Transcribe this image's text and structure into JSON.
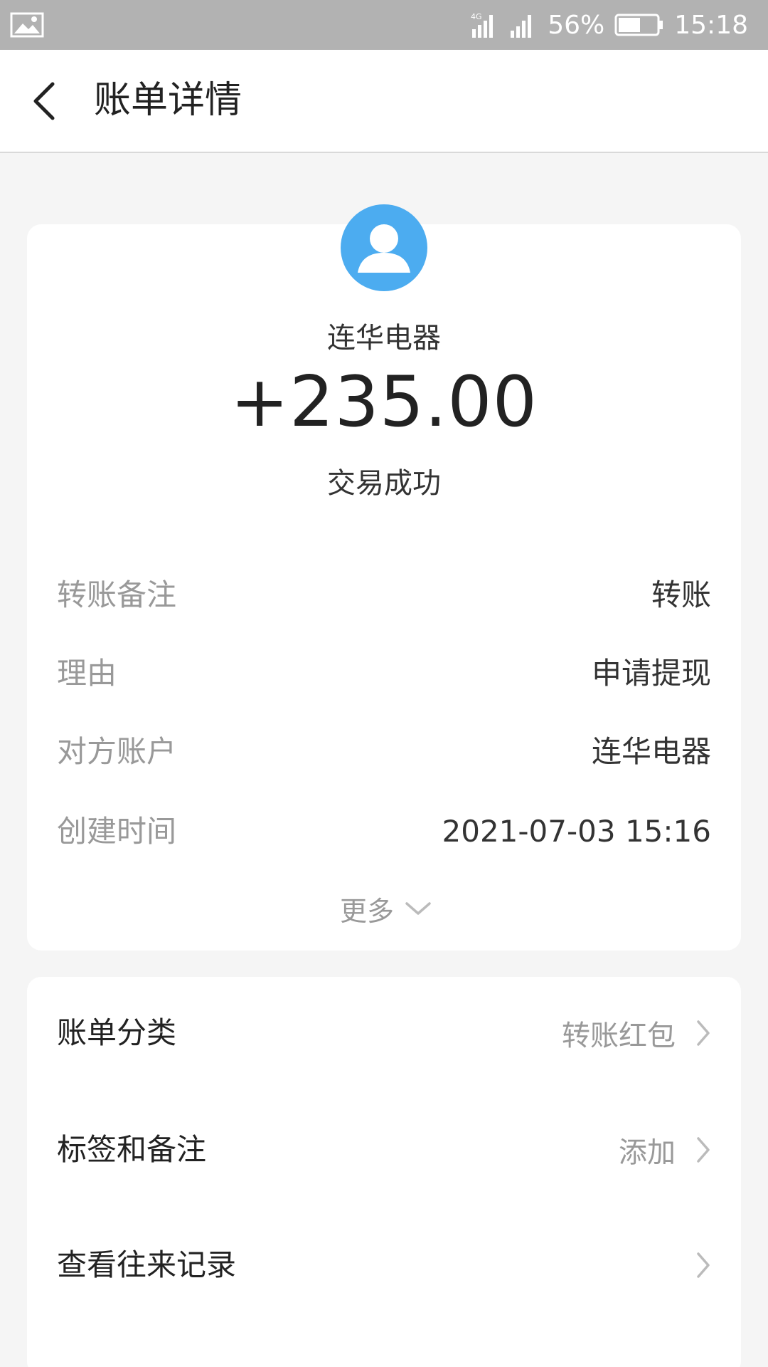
{
  "status_bar": {
    "network": "4G",
    "battery_percent": "56%",
    "time": "15:18"
  },
  "header": {
    "title": "账单详情"
  },
  "transaction": {
    "payee": "连华电器",
    "amount": "+235.00",
    "status": "交易成功"
  },
  "details": [
    {
      "label": "转账备注",
      "value": "转账"
    },
    {
      "label": "理由",
      "value": "申请提现"
    },
    {
      "label": "对方账户",
      "value": "连华电器"
    },
    {
      "label": "创建时间",
      "value": "2021-07-03 15:16"
    }
  ],
  "more": {
    "label": "更多"
  },
  "list": [
    {
      "label": "账单分类",
      "value": "转账红包"
    },
    {
      "label": "标签和备注",
      "value": "添加"
    },
    {
      "label": "查看往来记录",
      "value": ""
    }
  ],
  "colors": {
    "avatar_bg": "#4cacf0",
    "status_bar_bg": "#b2b2b2",
    "page_bg": "#f5f5f5"
  }
}
